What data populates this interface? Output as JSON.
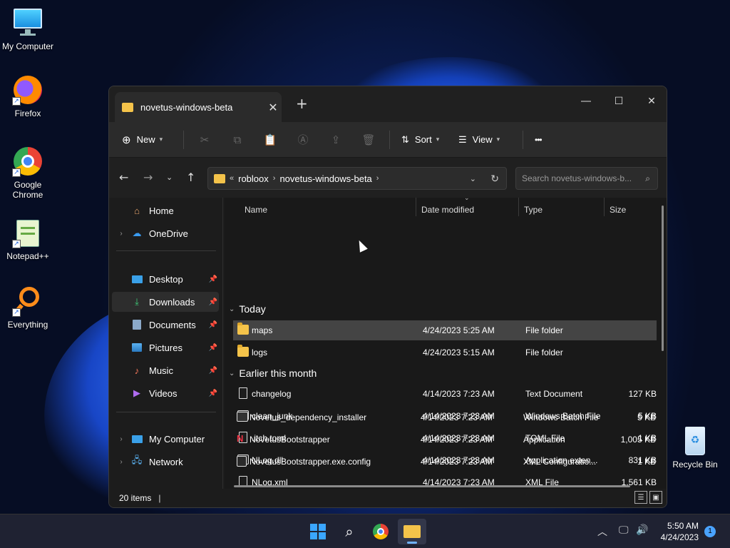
{
  "desktop": {
    "icons": [
      {
        "label": "My Computer"
      },
      {
        "label": "Firefox"
      },
      {
        "label": "Google Chrome"
      },
      {
        "label": "Notepad++"
      },
      {
        "label": "Everything"
      },
      {
        "label": "Recycle Bin"
      }
    ]
  },
  "window": {
    "tab_title": "novetus-windows-beta",
    "toolbar": {
      "new_label": "New",
      "sort_label": "Sort",
      "view_label": "View",
      "more_label": "•••"
    },
    "address": {
      "overflow": "«",
      "crumbs": [
        "robloox",
        "novetus-windows-beta"
      ]
    },
    "search_placeholder": "Search novetus-windows-b...",
    "sidebar": {
      "items": [
        {
          "label": "Home"
        },
        {
          "label": "OneDrive"
        },
        {
          "label": "Desktop"
        },
        {
          "label": "Downloads"
        },
        {
          "label": "Documents"
        },
        {
          "label": "Pictures"
        },
        {
          "label": "Music"
        },
        {
          "label": "Videos"
        },
        {
          "label": "My Computer"
        },
        {
          "label": "Network"
        }
      ]
    },
    "columns": {
      "name": "Name",
      "date": "Date modified",
      "type": "Type",
      "size": "Size"
    },
    "groups": {
      "today": "Today",
      "earlier": "Earlier this month"
    },
    "files": [
      {
        "name": "maps",
        "date": "4/24/2023 5:25 AM",
        "type": "File folder",
        "size": ""
      },
      {
        "name": "logs",
        "date": "4/24/2023 5:15 AM",
        "type": "File folder",
        "size": ""
      },
      {
        "name": "changelog",
        "date": "4/14/2023 7:23 AM",
        "type": "Text Document",
        "size": "127 KB"
      },
      {
        "name": "clean_junk",
        "date": "4/14/2023 7:23 AM",
        "type": "Windows Batch File",
        "size": "5 KB"
      },
      {
        "name": ".itch.toml",
        "date": "4/14/2023 7:23 AM",
        "type": "TOML File",
        "size": "1 KB"
      },
      {
        "name": "NLog.dll",
        "date": "4/14/2023 7:23 AM",
        "type": "Application exten...",
        "size": "831 KB"
      },
      {
        "name": "NLog.xml",
        "date": "4/14/2023 7:23 AM",
        "type": "XML File",
        "size": "1,561 KB"
      },
      {
        "name": "Novetus_dependency_installer",
        "date": "4/14/2023 7:23 AM",
        "type": "Windows Batch File",
        "size": "5 KB"
      },
      {
        "name": "NovetusBootstrapper",
        "date": "4/14/2023 7:23 AM",
        "type": "Application",
        "size": "1,005 KB"
      },
      {
        "name": "NovetusBootstrapper.exe.config",
        "date": "4/14/2023 7:23 AM",
        "type": "XML Configuratio...",
        "size": "1 KB"
      }
    ],
    "status_items": "20 items"
  },
  "taskbar": {
    "time": "5:50 AM",
    "date": "4/24/2023",
    "notification_count": "1"
  }
}
